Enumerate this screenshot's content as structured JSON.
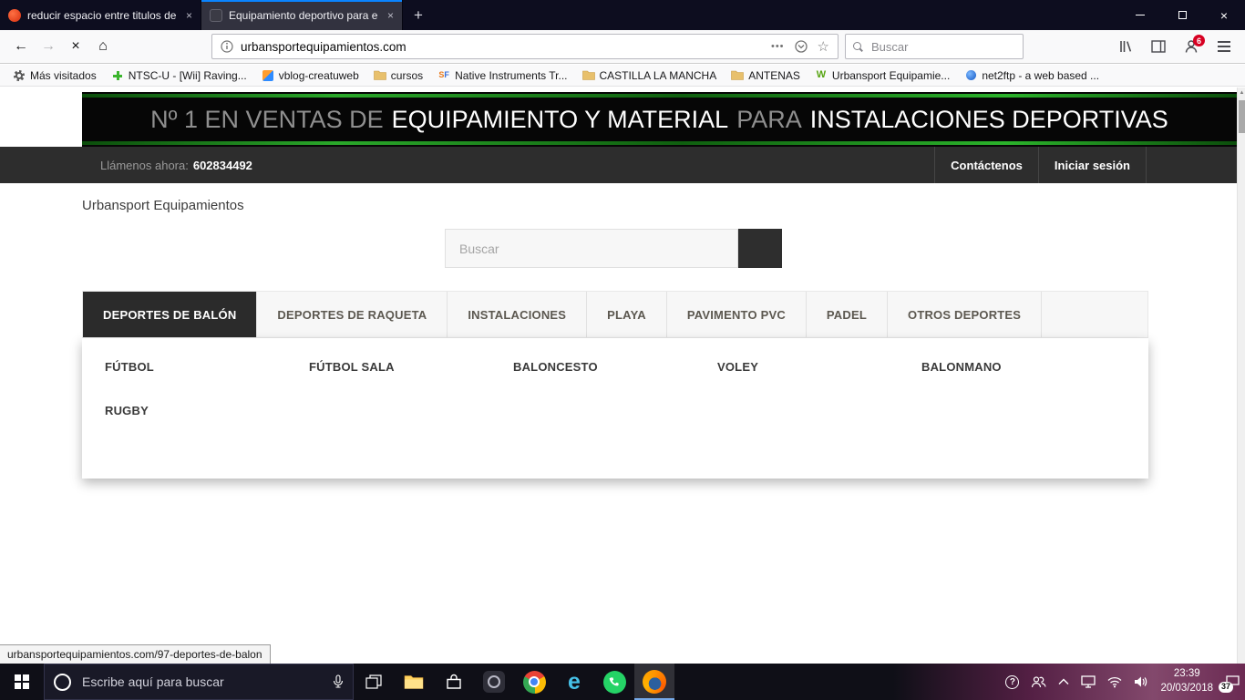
{
  "colors": {
    "accent_blue": "#0a84ff",
    "badge_red": "#d70022",
    "banner_green": "#2bb32b",
    "dark_panel": "#2b2b2b"
  },
  "browser": {
    "tabs": [
      {
        "title": "reducir espacio entre titulos de"
      },
      {
        "title": "Equipamiento deportivo para e"
      }
    ],
    "nav": {
      "url": "urbansportequipamientos.com",
      "search_placeholder": "Buscar",
      "account_badge": "6"
    },
    "bookmarks": [
      "Más visitados",
      "NTSC-U - [Wii] Raving...",
      "vblog-creatuweb",
      "cursos",
      "Native Instruments Tr...",
      "CASTILLA LA MANCHA",
      "ANTENAS",
      "Urbansport Equipamie...",
      "net2ftp - a web based ..."
    ],
    "status_link": "urbansportequipamientos.com/97-deportes-de-balon"
  },
  "site": {
    "banner": {
      "seg1": "Nº 1 EN VENTAS DE",
      "seg2": "EQUIPAMIENTO Y MATERIAL",
      "seg3": "PARA",
      "seg4": "INSTALACIONES DEPORTIVAS"
    },
    "topbar": {
      "phone_label": "Llámenos ahora:",
      "phone_number": "602834492",
      "contact": "Contáctenos",
      "login": "Iniciar sesión"
    },
    "logo": "Urbansport Equipamientos",
    "search_placeholder": "Buscar",
    "menu": [
      "DEPORTES DE BALÓN",
      "DEPORTES DE RAQUETA",
      "INSTALACIONES",
      "PLAYA",
      "PAVIMENTO PVC",
      "PADEL",
      "OTROS DEPORTES"
    ],
    "submenu": [
      "FÚTBOL",
      "FÚTBOL SALA",
      "BALONCESTO",
      "VOLEY",
      "BALONMANO",
      "RUGBY"
    ]
  },
  "taskbar": {
    "search_placeholder": "Escribe aquí para buscar",
    "clock_time": "23:39",
    "clock_date": "20/03/2018",
    "notification_count": "37"
  }
}
